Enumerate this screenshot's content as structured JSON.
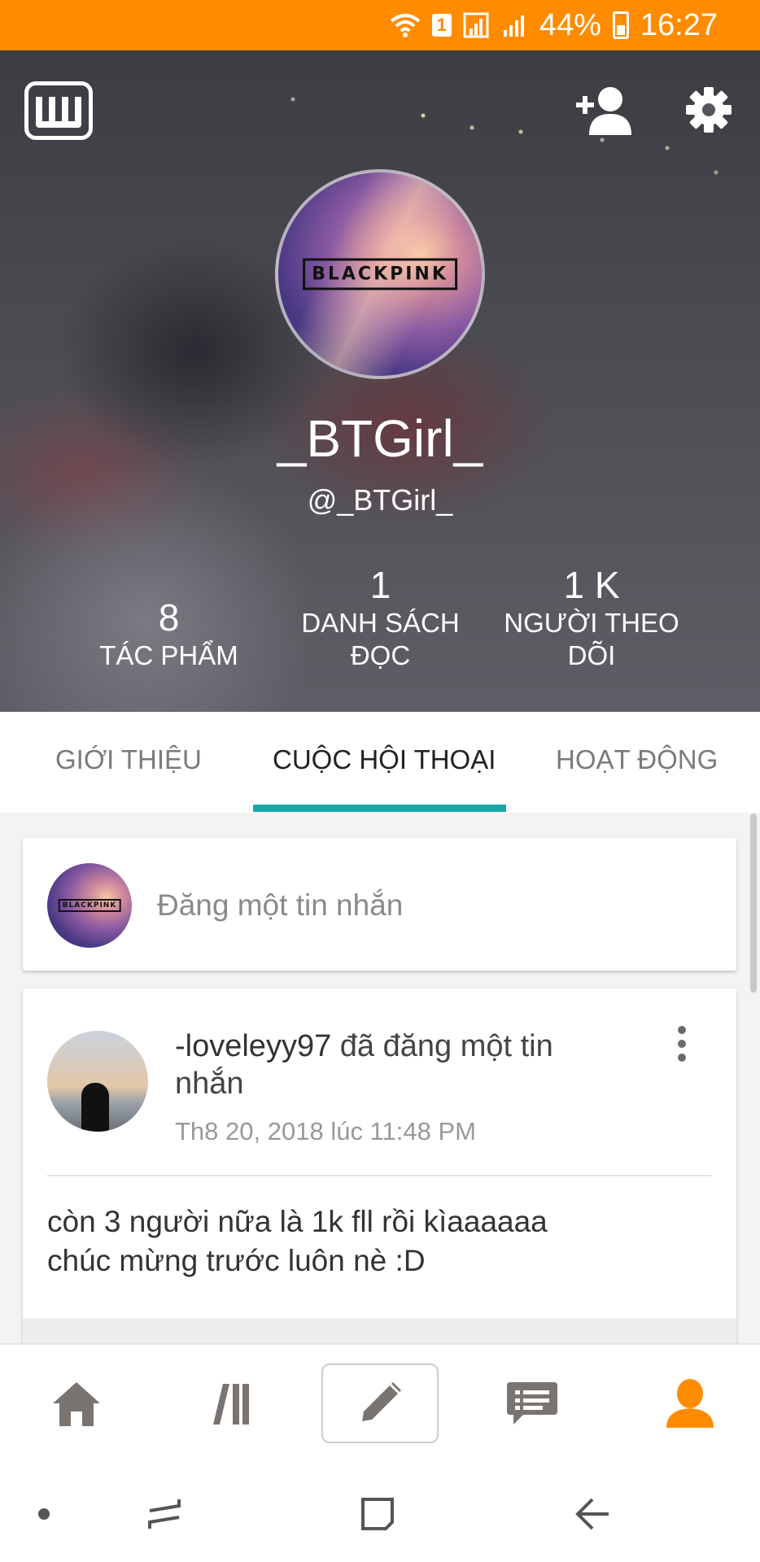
{
  "status_bar": {
    "sim_badge": "1",
    "battery": "44%",
    "time": "16:27"
  },
  "profile": {
    "display_name": "_BTGirl_",
    "username": "@_BTGirl_",
    "avatar_text": "BLACKPINK",
    "stats": [
      {
        "value": "8",
        "label": "TÁC PHẨM"
      },
      {
        "value": "1",
        "label": "DANH SÁCH ĐỌC"
      },
      {
        "value": "1 K",
        "label": "NGƯỜI THEO DÕI"
      }
    ]
  },
  "tabs": [
    {
      "label": "GIỚI THIỆU"
    },
    {
      "label": "CUỘC HỘI THOẠI"
    },
    {
      "label": "HOẠT ĐỘNG"
    }
  ],
  "post_box": {
    "placeholder": "Đăng một tin nhắn",
    "avatar_text": "BLACKPINK"
  },
  "messages": [
    {
      "author": "-loveleyy97",
      "action": "đã đăng một tin nhắn",
      "timestamp": "Th8 20, 2018 lúc 11:48 PM",
      "body_line1": "còn 3 người nữa là 1k fll rồi kìaaaaaa",
      "body_line2": "chúc mừng trước luôn nè :D"
    }
  ],
  "colors": {
    "status_bar": "#ff8c00",
    "tab_active_underline": "#16a9a8",
    "nav_active": "#ff8c00",
    "nav_inactive": "#7a7470"
  },
  "icons": {
    "logo": "wattpad-w-logo-icon",
    "add_user": "add-user-icon",
    "settings": "gear-icon",
    "more": "more-vertical-icon",
    "home": "home-icon",
    "library": "library-icon",
    "write": "pencil-icon",
    "messages": "chat-icon",
    "profile": "person-icon"
  }
}
